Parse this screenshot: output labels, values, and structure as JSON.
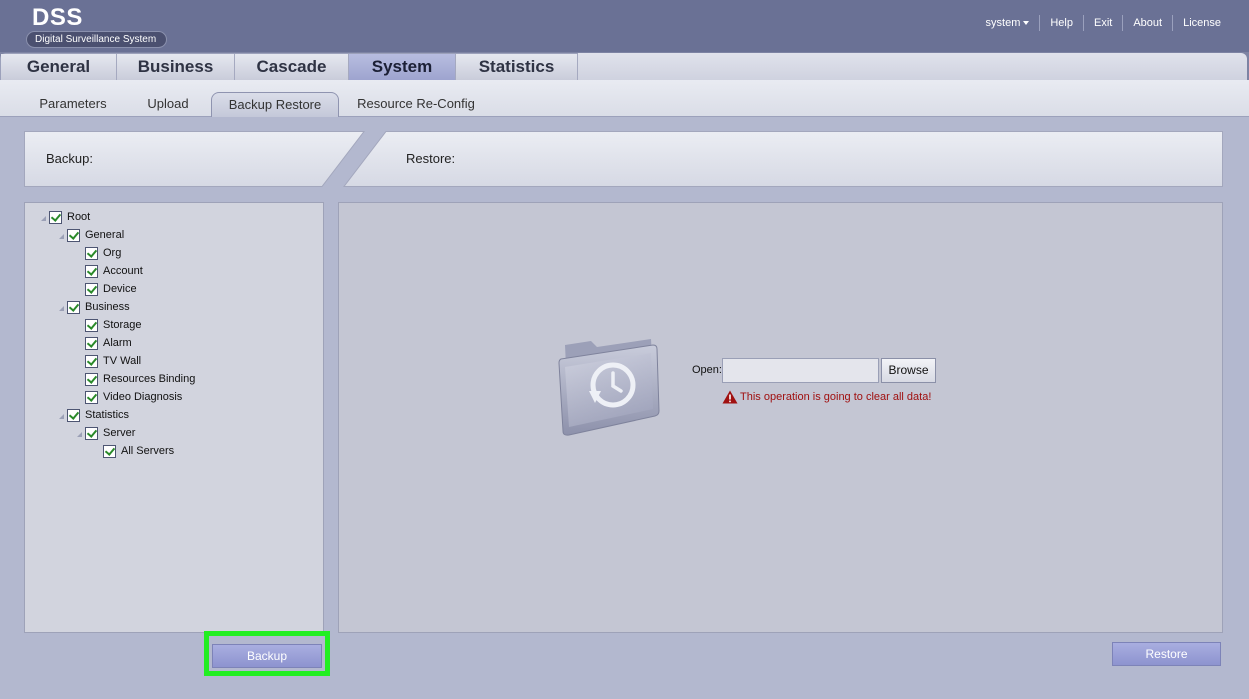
{
  "header": {
    "logo_title": "DSS",
    "logo_subtitle": "Digital Surveillance System",
    "user_menu": "system",
    "links": [
      "Help",
      "Exit",
      "About",
      "License"
    ]
  },
  "main_tabs": [
    "General",
    "Business",
    "Cascade",
    "System",
    "Statistics"
  ],
  "active_main_tab": "System",
  "sub_tabs": [
    "Parameters",
    "Upload",
    "Backup Restore",
    "Resource Re-Config"
  ],
  "active_sub_tab": "Backup Restore",
  "sections": {
    "backup_label": "Backup:",
    "restore_label": "Restore:"
  },
  "tree": {
    "root": "Root",
    "general": "General",
    "org": "Org",
    "account": "Account",
    "device": "Device",
    "business": "Business",
    "storage": "Storage",
    "alarm": "Alarm",
    "tv_wall": "TV Wall",
    "resources_binding": "Resources Binding",
    "video_diagnosis": "Video Diagnosis",
    "statistics": "Statistics",
    "server": "Server",
    "all_servers": "All Servers"
  },
  "restore": {
    "open_label": "Open:",
    "open_value": "",
    "browse_label": "Browse",
    "warning": "This operation is going to clear all data!"
  },
  "buttons": {
    "backup": "Backup",
    "restore": "Restore"
  },
  "colors": {
    "highlight": "#22ee22",
    "warning": "#a01010",
    "header": "#6a7195"
  }
}
